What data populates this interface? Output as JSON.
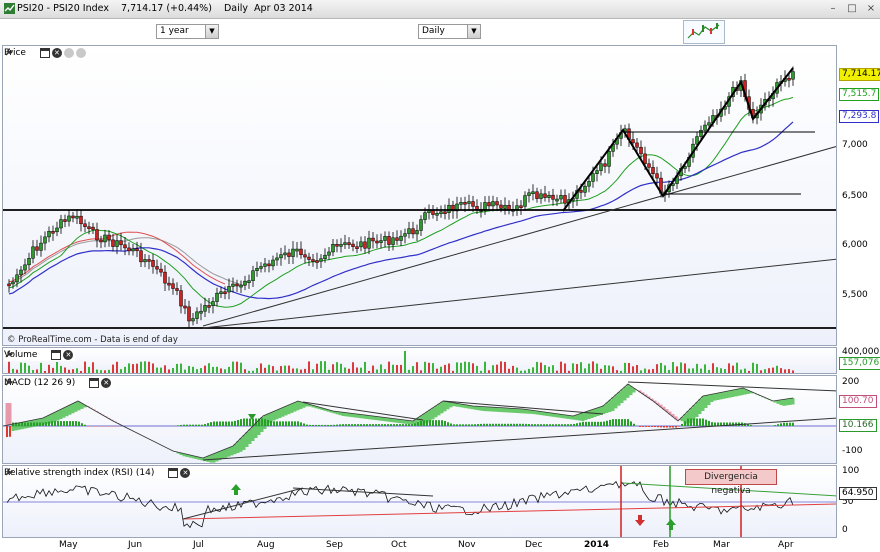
{
  "window": {
    "title": "PSI20 - PSI20 Index    7,714.17 (+0.44%)    Daily  Apr 03 2014",
    "controls": [
      "–",
      "□",
      "×"
    ]
  },
  "toolbar": {
    "period": "1 year",
    "interval": "Daily",
    "chart_type_icon": "chart-style-icon"
  },
  "colors": {
    "price_badge": "#f0f000",
    "ma_green": "#1fa01f",
    "ma_blue": "#3030c8",
    "ma_red": "#e05050",
    "volume_green": "#3ab53a",
    "volume_red": "#d93a3a",
    "macd_fill_green": "#3cba3c",
    "macd_fill_red": "#e07a90"
  },
  "panes": {
    "price": {
      "label": "Price",
      "icons": [
        "wrench-icon",
        "window-icon",
        "close-icon",
        "settings-icon",
        "add-icon"
      ],
      "credit": "© ProRealTime.com - Data is end of day",
      "ticks": [
        "7,000",
        "6,500",
        "6,000",
        "5,500"
      ],
      "badges": [
        {
          "text": "7,714.17",
          "kind": "last"
        },
        {
          "text": "7,515.7",
          "kind": "ma-short"
        },
        {
          "text": "7,293.8",
          "kind": "ma-long"
        }
      ]
    },
    "volume": {
      "label": "Volume",
      "icons": [
        "wrench-icon",
        "window-icon",
        "close-icon"
      ],
      "ticks": [
        "400,000"
      ],
      "badges": [
        {
          "text": "157,076",
          "kind": "volume"
        }
      ]
    },
    "macd": {
      "label": "MACD (12 26 9)",
      "icons": [
        "wrench-icon",
        "window-icon",
        "close-icon"
      ],
      "ticks": [
        "200",
        "100",
        "0",
        "-100"
      ],
      "badges": [
        {
          "text": "100.70",
          "kind": "macd"
        },
        {
          "text": "10.166",
          "kind": "hist"
        }
      ]
    },
    "rsi": {
      "label": "Relative strength index (RSI) (14)",
      "icons": [
        "wrench-icon",
        "window-icon",
        "close-icon"
      ],
      "ticks": [
        "100",
        "50",
        "0"
      ],
      "badges": [
        {
          "text": "64.950",
          "kind": "rsi"
        }
      ],
      "annotation": "Divergencia negativa"
    }
  },
  "xaxis": [
    "May",
    "Jun",
    "Jul",
    "Aug",
    "Sep",
    "Oct",
    "Nov",
    "Dec",
    "2014",
    "Feb",
    "Mar",
    "Apr"
  ]
}
